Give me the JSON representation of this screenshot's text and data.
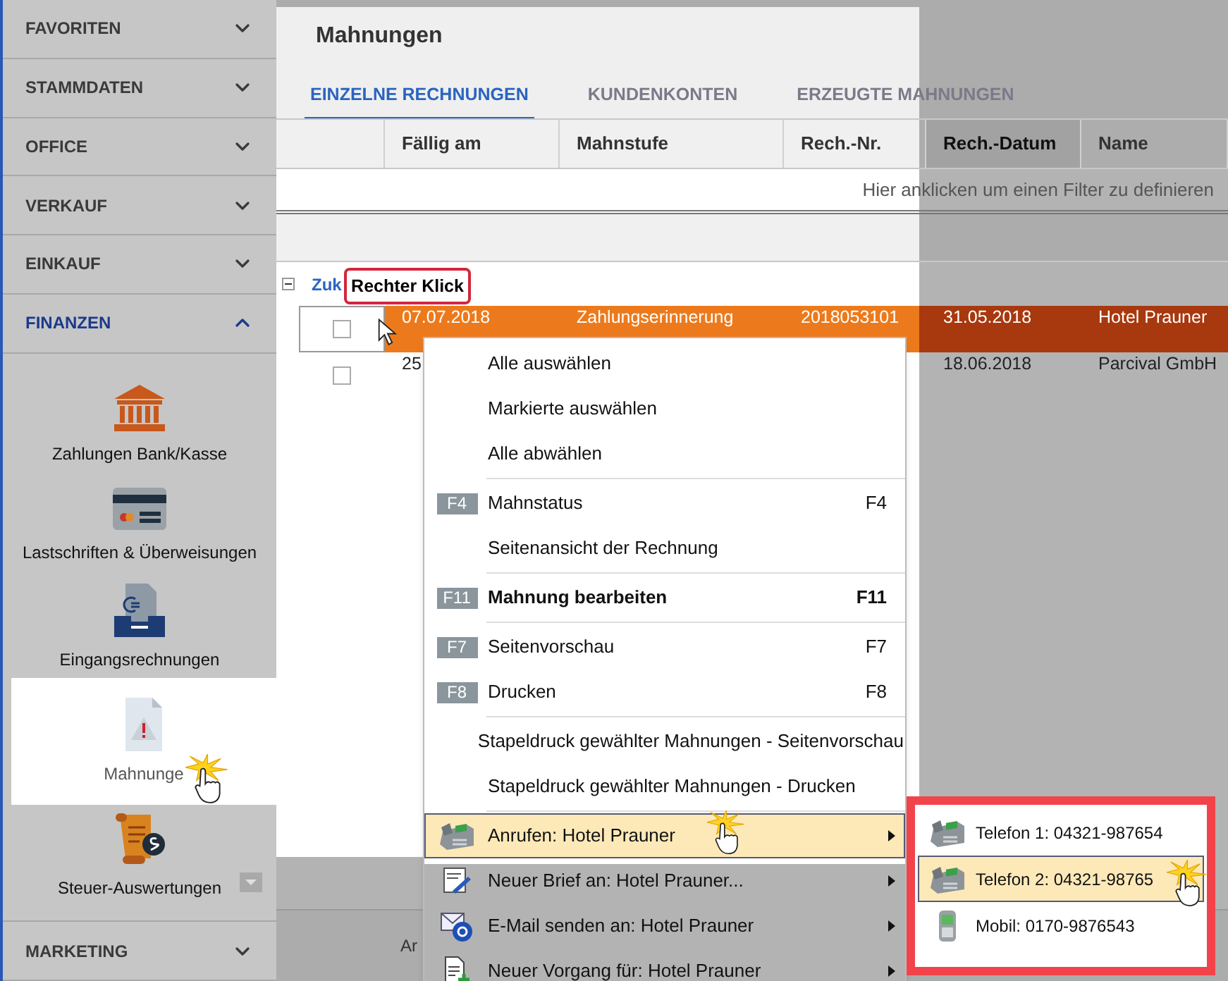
{
  "sidebar": {
    "sections": [
      {
        "label": "FAVORITEN",
        "expanded": false
      },
      {
        "label": "STAMMDATEN",
        "expanded": false
      },
      {
        "label": "OFFICE",
        "expanded": false
      },
      {
        "label": "VERKAUF",
        "expanded": false
      },
      {
        "label": "EINKAUF",
        "expanded": false
      },
      {
        "label": "FINANZEN",
        "expanded": true
      }
    ],
    "items": [
      {
        "label": "Zahlungen Bank/Kasse",
        "selected": false
      },
      {
        "label": "Lastschriften & Überweisungen",
        "selected": false
      },
      {
        "label": "Eingangsrechnungen",
        "selected": false
      },
      {
        "label": "Mahnunge",
        "selected": true
      },
      {
        "label": "Steuer-Auswertungen",
        "selected": false
      }
    ],
    "bottom_sections": [
      {
        "label": "MARKETING",
        "expanded": false
      }
    ]
  },
  "page": {
    "title": "Mahnungen",
    "tabs": [
      {
        "label": "EINZELNE RECHNUNGEN",
        "selected": true
      },
      {
        "label": "KUNDENKONTEN",
        "selected": false
      },
      {
        "label": "ERZEUGTE MAHNUNGEN",
        "selected": false
      }
    ]
  },
  "table": {
    "columns": [
      {
        "label": "Fällig am",
        "sorted": false
      },
      {
        "label": "Mahnstufe",
        "sorted": false
      },
      {
        "label": "Rech.-Nr.",
        "sorted": false
      },
      {
        "label": "Rech.-Datum",
        "sorted": true
      },
      {
        "label": "Name",
        "sorted": false
      }
    ],
    "filter_hint": "Hier anklicken um einen Filter zu definieren",
    "group": {
      "label": "Zuk",
      "expanded": true
    },
    "rows": [
      {
        "selected": true,
        "checked": false,
        "cells": [
          "07.07.2018",
          "Zahlungserinnerung",
          "2018053101",
          "31.05.2018",
          "Hotel Prauner"
        ]
      },
      {
        "selected": false,
        "checked": false,
        "cells": [
          "25",
          null,
          null,
          "18.06.2018",
          "Parcival GmbH"
        ]
      }
    ]
  },
  "footer_text": "Ar",
  "callout": "Rechter Klick",
  "context_menu": {
    "items": [
      {
        "kind": "item",
        "label": "Alle auswählen"
      },
      {
        "kind": "item",
        "label": "Markierte auswählen"
      },
      {
        "kind": "item",
        "label": "Alle abwählen"
      },
      {
        "kind": "separator"
      },
      {
        "kind": "item",
        "key": "F4",
        "label": "Mahnstatus",
        "shortcut": "F4"
      },
      {
        "kind": "item",
        "label": "Seitenansicht der Rechnung"
      },
      {
        "kind": "separator"
      },
      {
        "kind": "item",
        "key": "F11",
        "label": "Mahnung bearbeiten",
        "shortcut": "F11",
        "bold": true
      },
      {
        "kind": "separator"
      },
      {
        "kind": "item",
        "key": "F7",
        "label": "Seitenvorschau",
        "shortcut": "F7"
      },
      {
        "kind": "item",
        "key": "F8",
        "label": "Drucken",
        "shortcut": "F8"
      },
      {
        "kind": "separator"
      },
      {
        "kind": "item",
        "label": "Stapeldruck gewählter Mahnungen - Seitenvorschau"
      },
      {
        "kind": "item",
        "label": "Stapeldruck gewählter Mahnungen - Drucken"
      },
      {
        "kind": "separator"
      },
      {
        "kind": "item",
        "label": "Anrufen: Hotel Prauner",
        "submenu": true,
        "selected": true
      },
      {
        "kind": "item",
        "label": "Neuer Brief an: Hotel Prauner...",
        "submenu": true,
        "selected": false
      },
      {
        "kind": "item",
        "label": "E-Mail senden an: Hotel Prauner",
        "submenu": true,
        "selected": false
      },
      {
        "kind": "item",
        "label": "Neuer Vorgang für: Hotel Prauner",
        "submenu": true,
        "selected": false
      }
    ]
  },
  "submenu": {
    "items": [
      {
        "label": "Telefon 1: 04321-987654",
        "selected": false
      },
      {
        "label": "Telefon 2: 04321-98765",
        "selected": true
      },
      {
        "label": "Mobil: 0170-9876543",
        "selected": false
      }
    ]
  }
}
